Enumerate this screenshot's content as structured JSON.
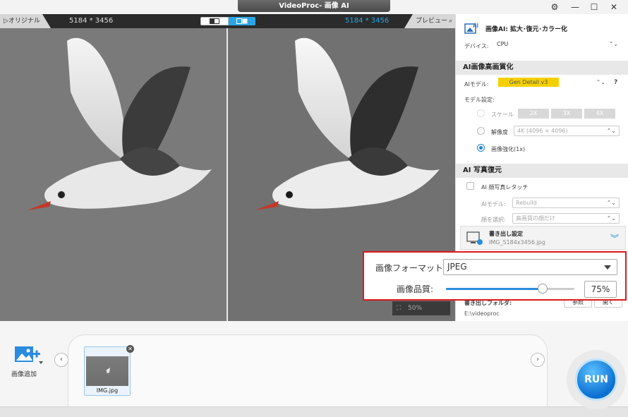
{
  "app": {
    "title": "VideoProc- 画像 AI"
  },
  "window_controls": {
    "settings": "⚙",
    "minimize": "—",
    "maximize": "☐",
    "close": "✕"
  },
  "preview": {
    "original_tab": "オリジナル",
    "original_resolution": "5184 * 3456",
    "preview_resolution": "5184 * 3456",
    "preview_tab": "プレビュー",
    "zoom": "50%"
  },
  "panel": {
    "header_title": "画像AI: 拡大･復元･カラー化",
    "device_label": "デバイス:",
    "device_value": "CPU",
    "upscale_section": "AI画像高画質化",
    "ai_model_label": "AIモデル:",
    "ai_model_value": "Gen Detail v3",
    "help": "?",
    "model_settings_label": "モデル設定:",
    "scale_label": "スケール",
    "scale_options": [
      "2X",
      "3X",
      "4X"
    ],
    "resolution_label": "解像度",
    "resolution_value": "4K (4096 × 4096)",
    "enhance_label": "画像強化(1x)",
    "restore_section": "AI 写真復元",
    "face_retouch_label": "AI 顔写真レタッチ",
    "restore_model_label": "AIモデル:",
    "restore_model_value": "Rebuild",
    "face_select_label": "顔を選択:",
    "face_select_value": "高画質の顔だけ",
    "export_title": "書き出し設定",
    "export_file": "IMG_5184x3456.jpg",
    "export_folder_label": "書き出しフォルダ:",
    "export_folder_path": "E:\\videoproc",
    "browse_button": "参照",
    "open_button": "開く"
  },
  "popup": {
    "format_label": "画像フォーマット:",
    "format_value": "JPEG",
    "quality_label": "画像品質:",
    "quality_value": "75%",
    "quality_percent": 75
  },
  "bottom": {
    "add_image_label": "画像追加",
    "thumbnail_name": "IMG.jpg",
    "run_label": "RUN"
  },
  "colors": {
    "accent": "#2aa6e6",
    "highlight_border": "#e01818",
    "model_badge": "#f5d000"
  }
}
